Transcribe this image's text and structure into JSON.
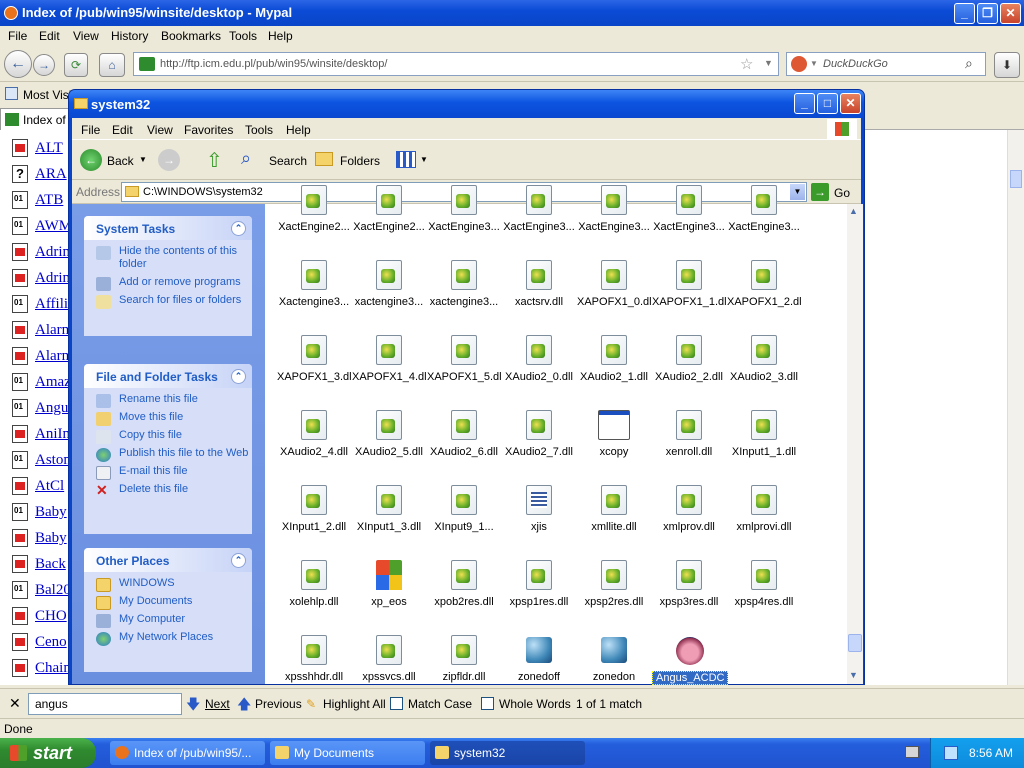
{
  "browser": {
    "title": "Index of /pub/win95/winsite/desktop - Mypal",
    "menu": [
      "File",
      "Edit",
      "View",
      "History",
      "Bookmarks",
      "Tools",
      "Help"
    ],
    "url": "http://ftp.icm.edu.pl/pub/win95/winsite/desktop/",
    "search_placeholder": "DuckDuckGo",
    "bookmark_label": "Most Visi",
    "tab_label": "Index of",
    "links": [
      {
        "text": "ALT",
        "icon": "red"
      },
      {
        "text": "ARA",
        "icon": "q"
      },
      {
        "text": "ATB",
        "icon": "bin"
      },
      {
        "text": "AWM",
        "icon": "bin"
      },
      {
        "text": "Adrin",
        "icon": "red"
      },
      {
        "text": "Adrin",
        "icon": "red"
      },
      {
        "text": "Affilia",
        "icon": "bin"
      },
      {
        "text": "Alarm",
        "icon": "red"
      },
      {
        "text": "Alarm",
        "icon": "red"
      },
      {
        "text": "Amaz",
        "icon": "bin"
      },
      {
        "text": "Angu",
        "icon": "bin"
      },
      {
        "text": "AniIn",
        "icon": "red"
      },
      {
        "text": "Aston",
        "icon": "bin"
      },
      {
        "text": "AtCl",
        "icon": "red"
      },
      {
        "text": "Baby",
        "icon": "bin"
      },
      {
        "text": "Baby",
        "icon": "red"
      },
      {
        "text": "Back",
        "icon": "red"
      },
      {
        "text": "Bal20",
        "icon": "bin"
      },
      {
        "text": "CHO",
        "icon": "red"
      },
      {
        "text": "Ceno",
        "icon": "red"
      },
      {
        "text": "Chain",
        "icon": "red"
      }
    ],
    "find": {
      "value": "angus",
      "next": "Next",
      "previous": "Previous",
      "highlight_all": "Highlight All",
      "match_case": "Match Case",
      "whole_words": "Whole Words",
      "result": "1 of 1 match"
    },
    "status": "Done"
  },
  "explorer": {
    "title": "system32",
    "menu": [
      "File",
      "Edit",
      "View",
      "Favorites",
      "Tools",
      "Help"
    ],
    "toolbar": {
      "back": "Back",
      "search": "Search",
      "folders": "Folders"
    },
    "address_label": "Address",
    "address": "C:\\WINDOWS\\system32",
    "go": "Go",
    "system_tasks": {
      "title": "System Tasks",
      "items": [
        "Hide the contents of this folder",
        "Add or remove programs",
        "Search for files or folders"
      ]
    },
    "file_tasks": {
      "title": "File and Folder Tasks",
      "items": [
        "Rename this file",
        "Move this file",
        "Copy this file",
        "Publish this file to the Web",
        "E-mail this file",
        "Delete this file"
      ]
    },
    "other_places": {
      "title": "Other Places",
      "items": [
        "WINDOWS",
        "My Documents",
        "My Computer",
        "My Network Places"
      ]
    },
    "files": [
      [
        "XactEngine2...",
        "XactEngine2...",
        "XactEngine3...",
        "XactEngine3...",
        "XactEngine3...",
        "XactEngine3...",
        "XactEngine3..."
      ],
      [
        "Xactengine3...",
        "xactengine3...",
        "xactengine3...",
        "xactsrv.dll",
        "XAPOFX1_0.dll",
        "XAPOFX1_1.dll",
        "XAPOFX1_2.dll"
      ],
      [
        "XAPOFX1_3.dll",
        "XAPOFX1_4.dll",
        "XAPOFX1_5.dll",
        "XAudio2_0.dll",
        "XAudio2_1.dll",
        "XAudio2_2.dll",
        "XAudio2_3.dll"
      ],
      [
        "XAudio2_4.dll",
        "XAudio2_5.dll",
        "XAudio2_6.dll",
        "XAudio2_7.dll",
        "xcopy",
        "xenroll.dll",
        "XInput1_1.dll"
      ],
      [
        "XInput1_2.dll",
        "XInput1_3.dll",
        "XInput9_1...",
        "xjis",
        "xmllite.dll",
        "xmlprov.dll",
        "xmlprovi.dll"
      ],
      [
        "xolehlp.dll",
        "xp_eos",
        "xpob2res.dll",
        "xpsp1res.dll",
        "xpsp2res.dll",
        "xpsp3res.dll",
        "xpsp4res.dll"
      ],
      [
        "xpsshhdr.dll",
        "xpssvcs.dll",
        "zipfldr.dll",
        "zonedoff",
        "zonedon",
        "Angus_ACDC"
      ]
    ],
    "selected_file": "Angus_ACDC"
  },
  "taskbar": {
    "start": "start",
    "items": [
      "Index of /pub/win95/...",
      "My Documents",
      "system32"
    ],
    "clock": "8:56 AM"
  },
  "colors": {
    "xp_blue": "#0a45c8",
    "task_pane": "#d6dff7",
    "link": "#0000cc",
    "selection": "#316ac5"
  }
}
